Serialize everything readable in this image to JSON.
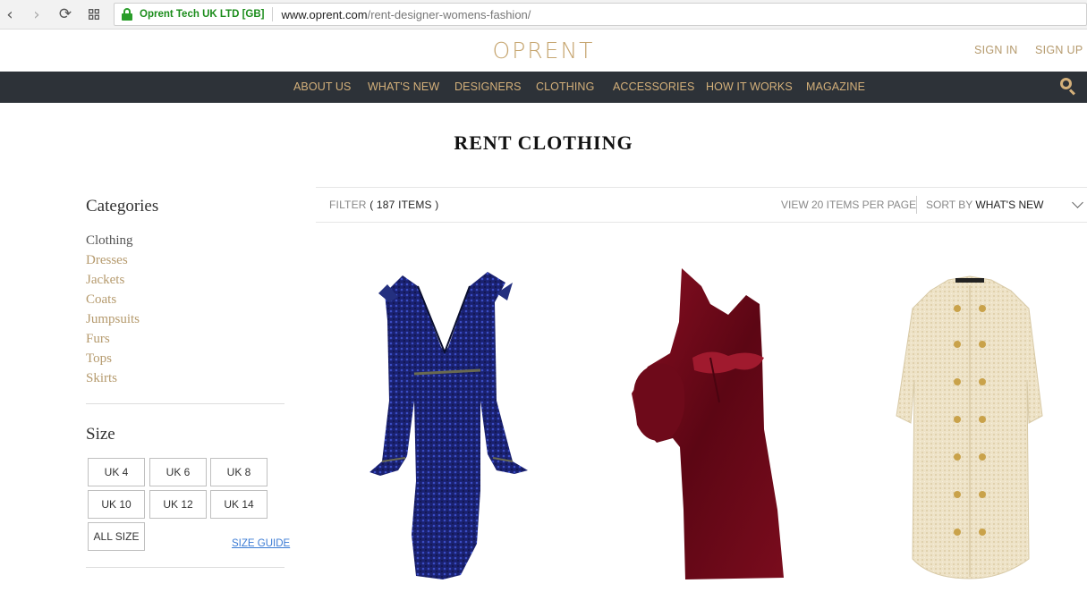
{
  "browser": {
    "cert_label": "Oprent Tech UK LTD [GB]",
    "url_host": "www.oprent.com",
    "url_path": "/rent-designer-womens-fashion/"
  },
  "header": {
    "logo": "OPRENT",
    "sign_in": "SIGN IN",
    "sign_up": "SIGN UP"
  },
  "nav": [
    "ABOUT US",
    "WHAT'S NEW",
    "DESIGNERS",
    "CLOTHING",
    "ACCESSORIES",
    "HOW IT WORKS",
    "MAGAZINE"
  ],
  "page_title": "RENT CLOTHING",
  "sidebar": {
    "categories_heading": "Categories",
    "categories": [
      "Clothing",
      "Dresses",
      "Jackets",
      "Coats",
      "Jumpsuits",
      "Furs",
      "Tops",
      "Skirts"
    ],
    "size_heading": "Size",
    "sizes": [
      "UK 4",
      "UK 6",
      "UK 8",
      "UK 10",
      "UK 12",
      "UK 14",
      "ALL SIZE"
    ],
    "size_guide": "SIZE GUIDE"
  },
  "toolbar": {
    "filter_label": "FILTER",
    "filter_count": "( 187 ITEMS )",
    "per_page": "VIEW 20 ITEMS PER PAGE",
    "sort_label": "SORT BY",
    "sort_value": "WHAT'S NEW"
  },
  "colors": {
    "gold": "#c6a56f",
    "nav_bg": "#2d3238",
    "nav_text": "#d4b07a"
  }
}
